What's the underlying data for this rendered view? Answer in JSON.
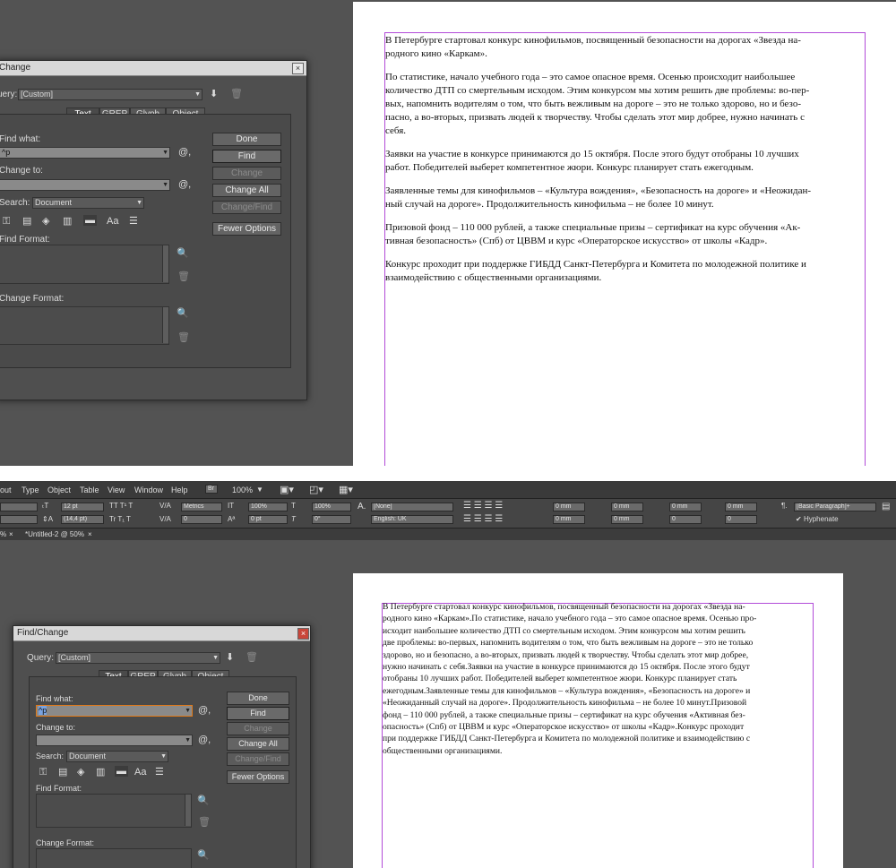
{
  "top": {
    "dialog": {
      "title": "Change",
      "query_label": "uery:",
      "query_value": "[Custom]",
      "tabs": [
        "Text",
        "GREP",
        "Glyph",
        "Object"
      ],
      "find_what_label": "Find what:",
      "find_what_value": "^p",
      "change_to_label": "Change to:",
      "change_to_value": "",
      "search_label": "Search:",
      "search_value": "Document",
      "find_format_label": "Find Format:",
      "change_format_label": "Change Format:",
      "buttons": [
        "Done",
        "Find",
        "Change",
        "Change All",
        "Change/Find",
        "Fewer Options"
      ]
    },
    "document": {
      "paragraphs": [
        "В Петербурге стартовал конкурс кинофильмов, посвященный безопасности на дорогах «Звезда на-",
        "родного кино «Каркам».",
        "",
        "По статистике, начало учебного года – это самое опасное время. Осенью происходит наибольшее",
        "количество ДТП со смертельным исходом. Этим конкурсом мы хотим решить две проблемы: во-пер-",
        "вых, напомнить водителям о том, что быть вежливым на дороге – это не только здорово, но и безо-",
        "пасно, а во-вторых, призвать людей к творчеству. Чтобы сделать этот мир добрее, нужно начинать с",
        "себя.",
        "",
        "Заявки на участие в конкурсе принимаются до 15 октября. После этого будут отобраны 10 лучших",
        "работ. Победителей выберет компетентное жюри. Конкурс планирует стать ежегодным.",
        "",
        "Заявленные темы для кинофильмов – «Культура вождения», «Безопасность на дороге» и «Неожидан-",
        "ный случай на дороге». Продолжительность кинофильма – не более 10 минут.",
        "",
        "Призовой фонд – 110 000 рублей, а также специальные призы – сертификат на курс обучения «Ак-",
        "тивная безопасность» (Спб) от ЦВВМ и курс «Операторское искусство» от школы «Кадр».",
        "",
        "Конкурс проходит при поддержке ГИБДД Санкт-Петербурга и Комитета по молодежной политике и",
        "взаимодействию с общественными организациями."
      ]
    }
  },
  "app": {
    "menu": [
      "out",
      "Type",
      "Object",
      "Table",
      "View",
      "Window",
      "Help"
    ],
    "br_label": "Br",
    "zoom": "100%",
    "control": {
      "font_size": "12 pt",
      "leading": "(14,4 pt)",
      "kerning": "Metrics",
      "tracking": "0",
      "vscale": "100%",
      "hscale": "100%",
      "baseline": "0 pt",
      "skew": "0°",
      "char_style": "[None]",
      "language": "English: UK",
      "indent_values": [
        "0 mm",
        "0 mm",
        "0 mm",
        "0 mm",
        "0 mm",
        "0 mm",
        "0 mm",
        "0 mm",
        "0",
        "0"
      ],
      "para_style": "[Basic Paragraph]+",
      "hyphenate": "Hyphenate"
    },
    "doc_tabs": [
      "%",
      "*Untitled-2 @ 50%"
    ]
  },
  "bottom": {
    "dialog": {
      "title": "Find/Change",
      "query_label": "Query:",
      "query_value": "[Custom]",
      "tabs": [
        "Text",
        "GREP",
        "Glyph",
        "Object"
      ],
      "find_what_label": "Find what:",
      "find_what_value": "^p",
      "change_to_label": "Change to:",
      "change_to_value": "",
      "search_label": "Search:",
      "search_value": "Document",
      "find_format_label": "Find Format:",
      "change_format_label": "Change Format:",
      "buttons": [
        "Done",
        "Find",
        "Change",
        "Change All",
        "Change/Find",
        "Fewer Options"
      ]
    },
    "document": {
      "lines": [
        "В Петербурге стартовал конкурс кинофильмов, посвященный безопасности на дорогах «Звезда на-",
        "родного кино «Каркам».По статистике, начало учебного года – это самое опасное время. Осенью про-",
        "исходит наибольшее количество ДТП со смертельным исходом. Этим конкурсом мы хотим решить",
        "две проблемы: во-первых, напомнить водителям о том, что быть вежливым на дороге – это не только",
        "здорово, но и безопасно, а во-вторых, призвать людей к творчеству. Чтобы сделать этот мир добрее,",
        "нужно начинать с себя.Заявки на участие в конкурсе принимаются до 15 октября. После этого будут",
        "отобраны 10 лучших работ. Победителей выберет компетентное жюри. Конкурс планирует стать",
        "ежегодным.Заявленные темы для кинофильмов – «Культура вождения», «Безопасность на дороге» и",
        "«Неожиданный случай на дороге». Продолжительность кинофильма – не более 10 минут.Призовой",
        "фонд – 110 000 рублей, а также специальные призы – сертификат на курс обучения «Активная без-",
        "опасность» (Спб) от ЦВВМ и курс «Операторское искусство» от школы «Кадр».Конкурс проходит",
        "при поддержке ГИБДД Санкт-Петербурга и Комитета по молодежной политике и взаимодействию с",
        "общественными организациями."
      ]
    }
  },
  "colors": {
    "pasteboard": "#535353",
    "frame_guide": "#b24bd8",
    "pilcrow": "#3f7fd8",
    "find_highlight": "#e07a1a"
  }
}
